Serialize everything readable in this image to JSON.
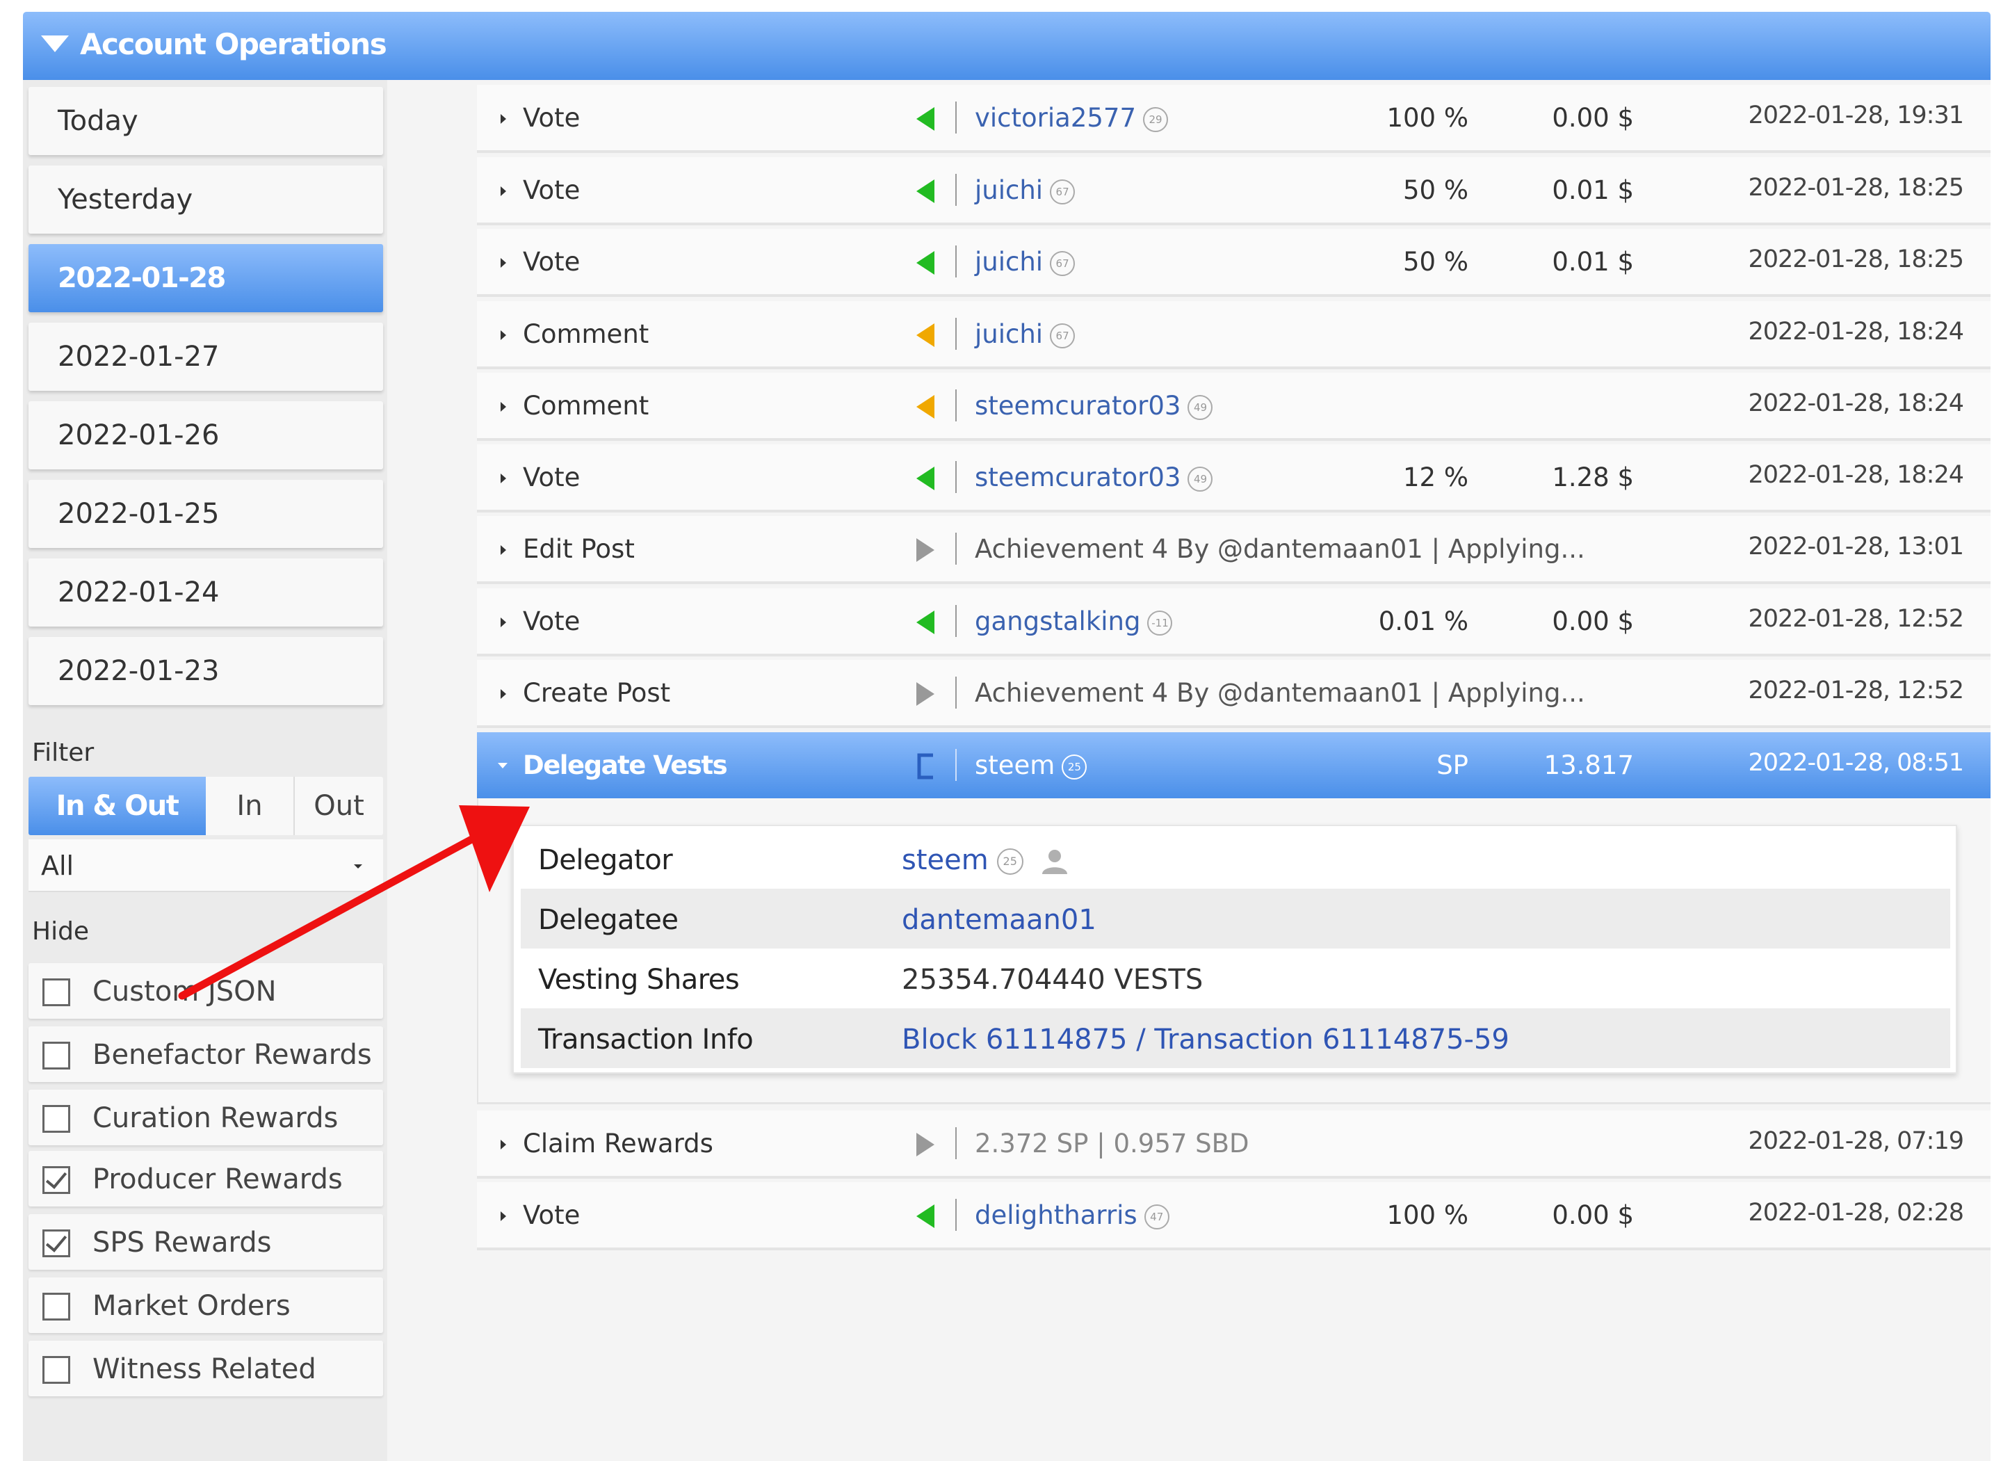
{
  "header": {
    "title": "Account Operations"
  },
  "sidebar": {
    "dates": [
      {
        "label": "Today",
        "active": false
      },
      {
        "label": "Yesterday",
        "active": false
      },
      {
        "label": "2022-01-28",
        "active": true
      },
      {
        "label": "2022-01-27",
        "active": false
      },
      {
        "label": "2022-01-26",
        "active": false
      },
      {
        "label": "2022-01-25",
        "active": false
      },
      {
        "label": "2022-01-24",
        "active": false
      },
      {
        "label": "2022-01-23",
        "active": false
      }
    ],
    "filter_label": "Filter",
    "filter_tabs": [
      "In & Out",
      "In",
      "Out"
    ],
    "filter_selected": "In & Out",
    "type_select": "All",
    "hide_label": "Hide",
    "hide_options": [
      {
        "label": "Custom JSON",
        "checked": false
      },
      {
        "label": "Benefactor Rewards",
        "checked": false
      },
      {
        "label": "Curation Rewards",
        "checked": false
      },
      {
        "label": "Producer Rewards",
        "checked": true
      },
      {
        "label": "SPS Rewards",
        "checked": true
      },
      {
        "label": "Market Orders",
        "checked": false
      },
      {
        "label": "Witness Related",
        "checked": false
      }
    ]
  },
  "operations": [
    {
      "op": "Vote",
      "direction": "in-green",
      "user": "victoria2577",
      "rep": "29",
      "pct": "100 %",
      "amount": "0.00 $",
      "time": "2022-01-28, 19:31"
    },
    {
      "op": "Vote",
      "direction": "in-green",
      "user": "juichi",
      "rep": "67",
      "pct": "50 %",
      "amount": "0.01 $",
      "time": "2022-01-28, 18:25"
    },
    {
      "op": "Vote",
      "direction": "in-green",
      "user": "juichi",
      "rep": "67",
      "pct": "50 %",
      "amount": "0.01 $",
      "time": "2022-01-28, 18:25"
    },
    {
      "op": "Comment",
      "direction": "in-orange",
      "user": "juichi",
      "rep": "67",
      "pct": "",
      "amount": "",
      "time": "2022-01-28, 18:24"
    },
    {
      "op": "Comment",
      "direction": "in-orange",
      "user": "steemcurator03",
      "rep": "49",
      "pct": "",
      "amount": "",
      "time": "2022-01-28, 18:24"
    },
    {
      "op": "Vote",
      "direction": "in-green",
      "user": "steemcurator03",
      "rep": "49",
      "pct": "12 %",
      "amount": "1.28 $",
      "time": "2022-01-28, 18:24"
    },
    {
      "op": "Edit Post",
      "direction": "out-grey",
      "text": "Achievement 4 By @dantemaan01  |  Applying...",
      "time": "2022-01-28, 13:01"
    },
    {
      "op": "Vote",
      "direction": "in-green",
      "user": "gangstalking",
      "rep": "-11",
      "pct": "0.01 %",
      "amount": "0.00 $",
      "time": "2022-01-28, 12:52"
    },
    {
      "op": "Create Post",
      "direction": "out-grey",
      "text": "Achievement 4 By @dantemaan01  |  Applying...",
      "time": "2022-01-28, 12:52"
    },
    {
      "op": "Delegate Vests",
      "direction": "bracket",
      "user": "steem",
      "rep": "25",
      "pct": "SP",
      "amount": "13.817",
      "time": "2022-01-28, 08:51",
      "active": true
    },
    {
      "op": "Claim Rewards",
      "direction": "out-grey",
      "text": "2.372 SP  |  0.957 SBD",
      "time": "2022-01-28, 07:19"
    },
    {
      "op": "Vote",
      "direction": "in-green",
      "user": "delightharris",
      "rep": "47",
      "pct": "100 %",
      "amount": "0.00 $",
      "time": "2022-01-28, 02:28"
    }
  ],
  "detail": {
    "delegator_label": "Delegator",
    "delegator": "steem",
    "delegator_rep": "25",
    "delegatee_label": "Delegatee",
    "delegatee": "dantemaan01",
    "vesting_label": "Vesting Shares",
    "vesting": "25354.704440 VESTS",
    "tx_label": "Transaction Info",
    "tx": "Block 61114875 / Transaction 61114875-59"
  },
  "colors": {
    "accent": "#4a8fe9",
    "link": "#3a62b0",
    "green": "#22bb22",
    "orange": "#f0a800",
    "annotation": "#ee1111"
  },
  "icons": {
    "header_toggle": "triangle-down-icon",
    "row_toggle": "caret-right-icon",
    "person": "user-icon"
  }
}
